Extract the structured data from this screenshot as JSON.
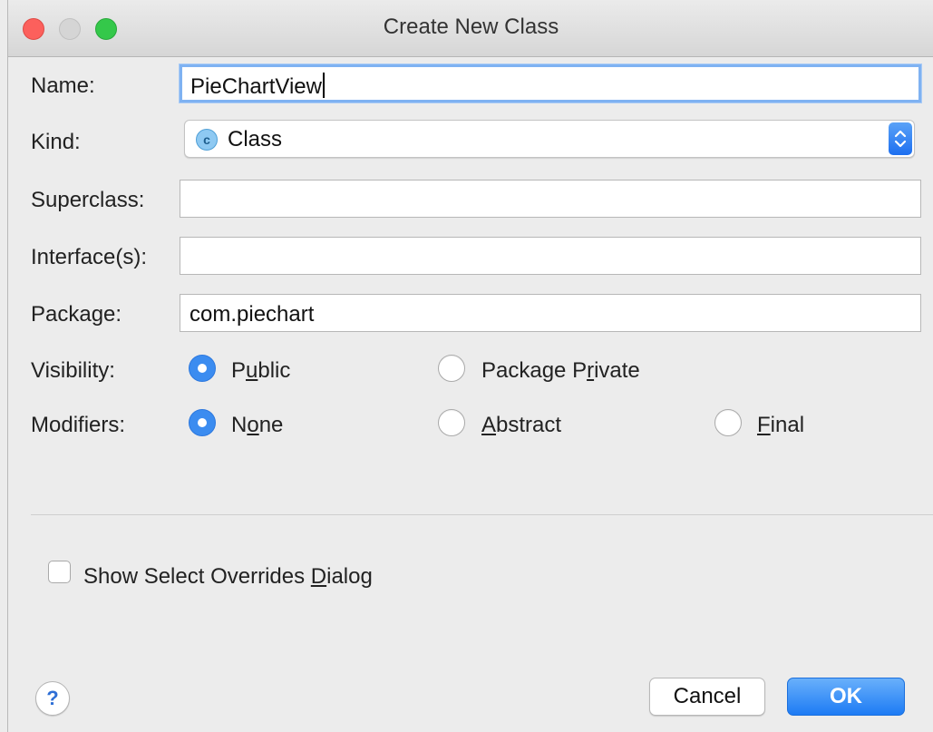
{
  "window": {
    "title": "Create New Class"
  },
  "form": {
    "name": {
      "label": "Name:",
      "value": "PieChartView"
    },
    "kind": {
      "label": "Kind:",
      "value": "Class",
      "icon": "class-c-icon"
    },
    "superclass": {
      "label": "Superclass:",
      "value": ""
    },
    "interfaces": {
      "label": "Interface(s):",
      "value": ""
    },
    "package": {
      "label": "Package:",
      "value": "com.piechart"
    },
    "visibility": {
      "label": "Visibility:",
      "options": [
        {
          "pre": "P",
          "ul": "u",
          "post": "blic",
          "selected": true
        },
        {
          "pre": "Package P",
          "ul": "r",
          "post": "ivate",
          "selected": false
        }
      ]
    },
    "modifiers": {
      "label": "Modifiers:",
      "options": [
        {
          "pre": "N",
          "ul": "o",
          "post": "ne",
          "selected": true
        },
        {
          "pre": "",
          "ul": "A",
          "post": "bstract",
          "selected": false
        },
        {
          "pre": "",
          "ul": "F",
          "post": "inal",
          "selected": false
        }
      ]
    }
  },
  "options": {
    "show_overrides": {
      "pre": "Show Select Overrides ",
      "ul": "D",
      "post": "ialog",
      "checked": false
    }
  },
  "footer": {
    "help": "?",
    "cancel": "Cancel",
    "ok": "OK"
  },
  "colors": {
    "accent": "#3b8cf0",
    "close": "#fc605c",
    "maximize": "#34c84a"
  }
}
